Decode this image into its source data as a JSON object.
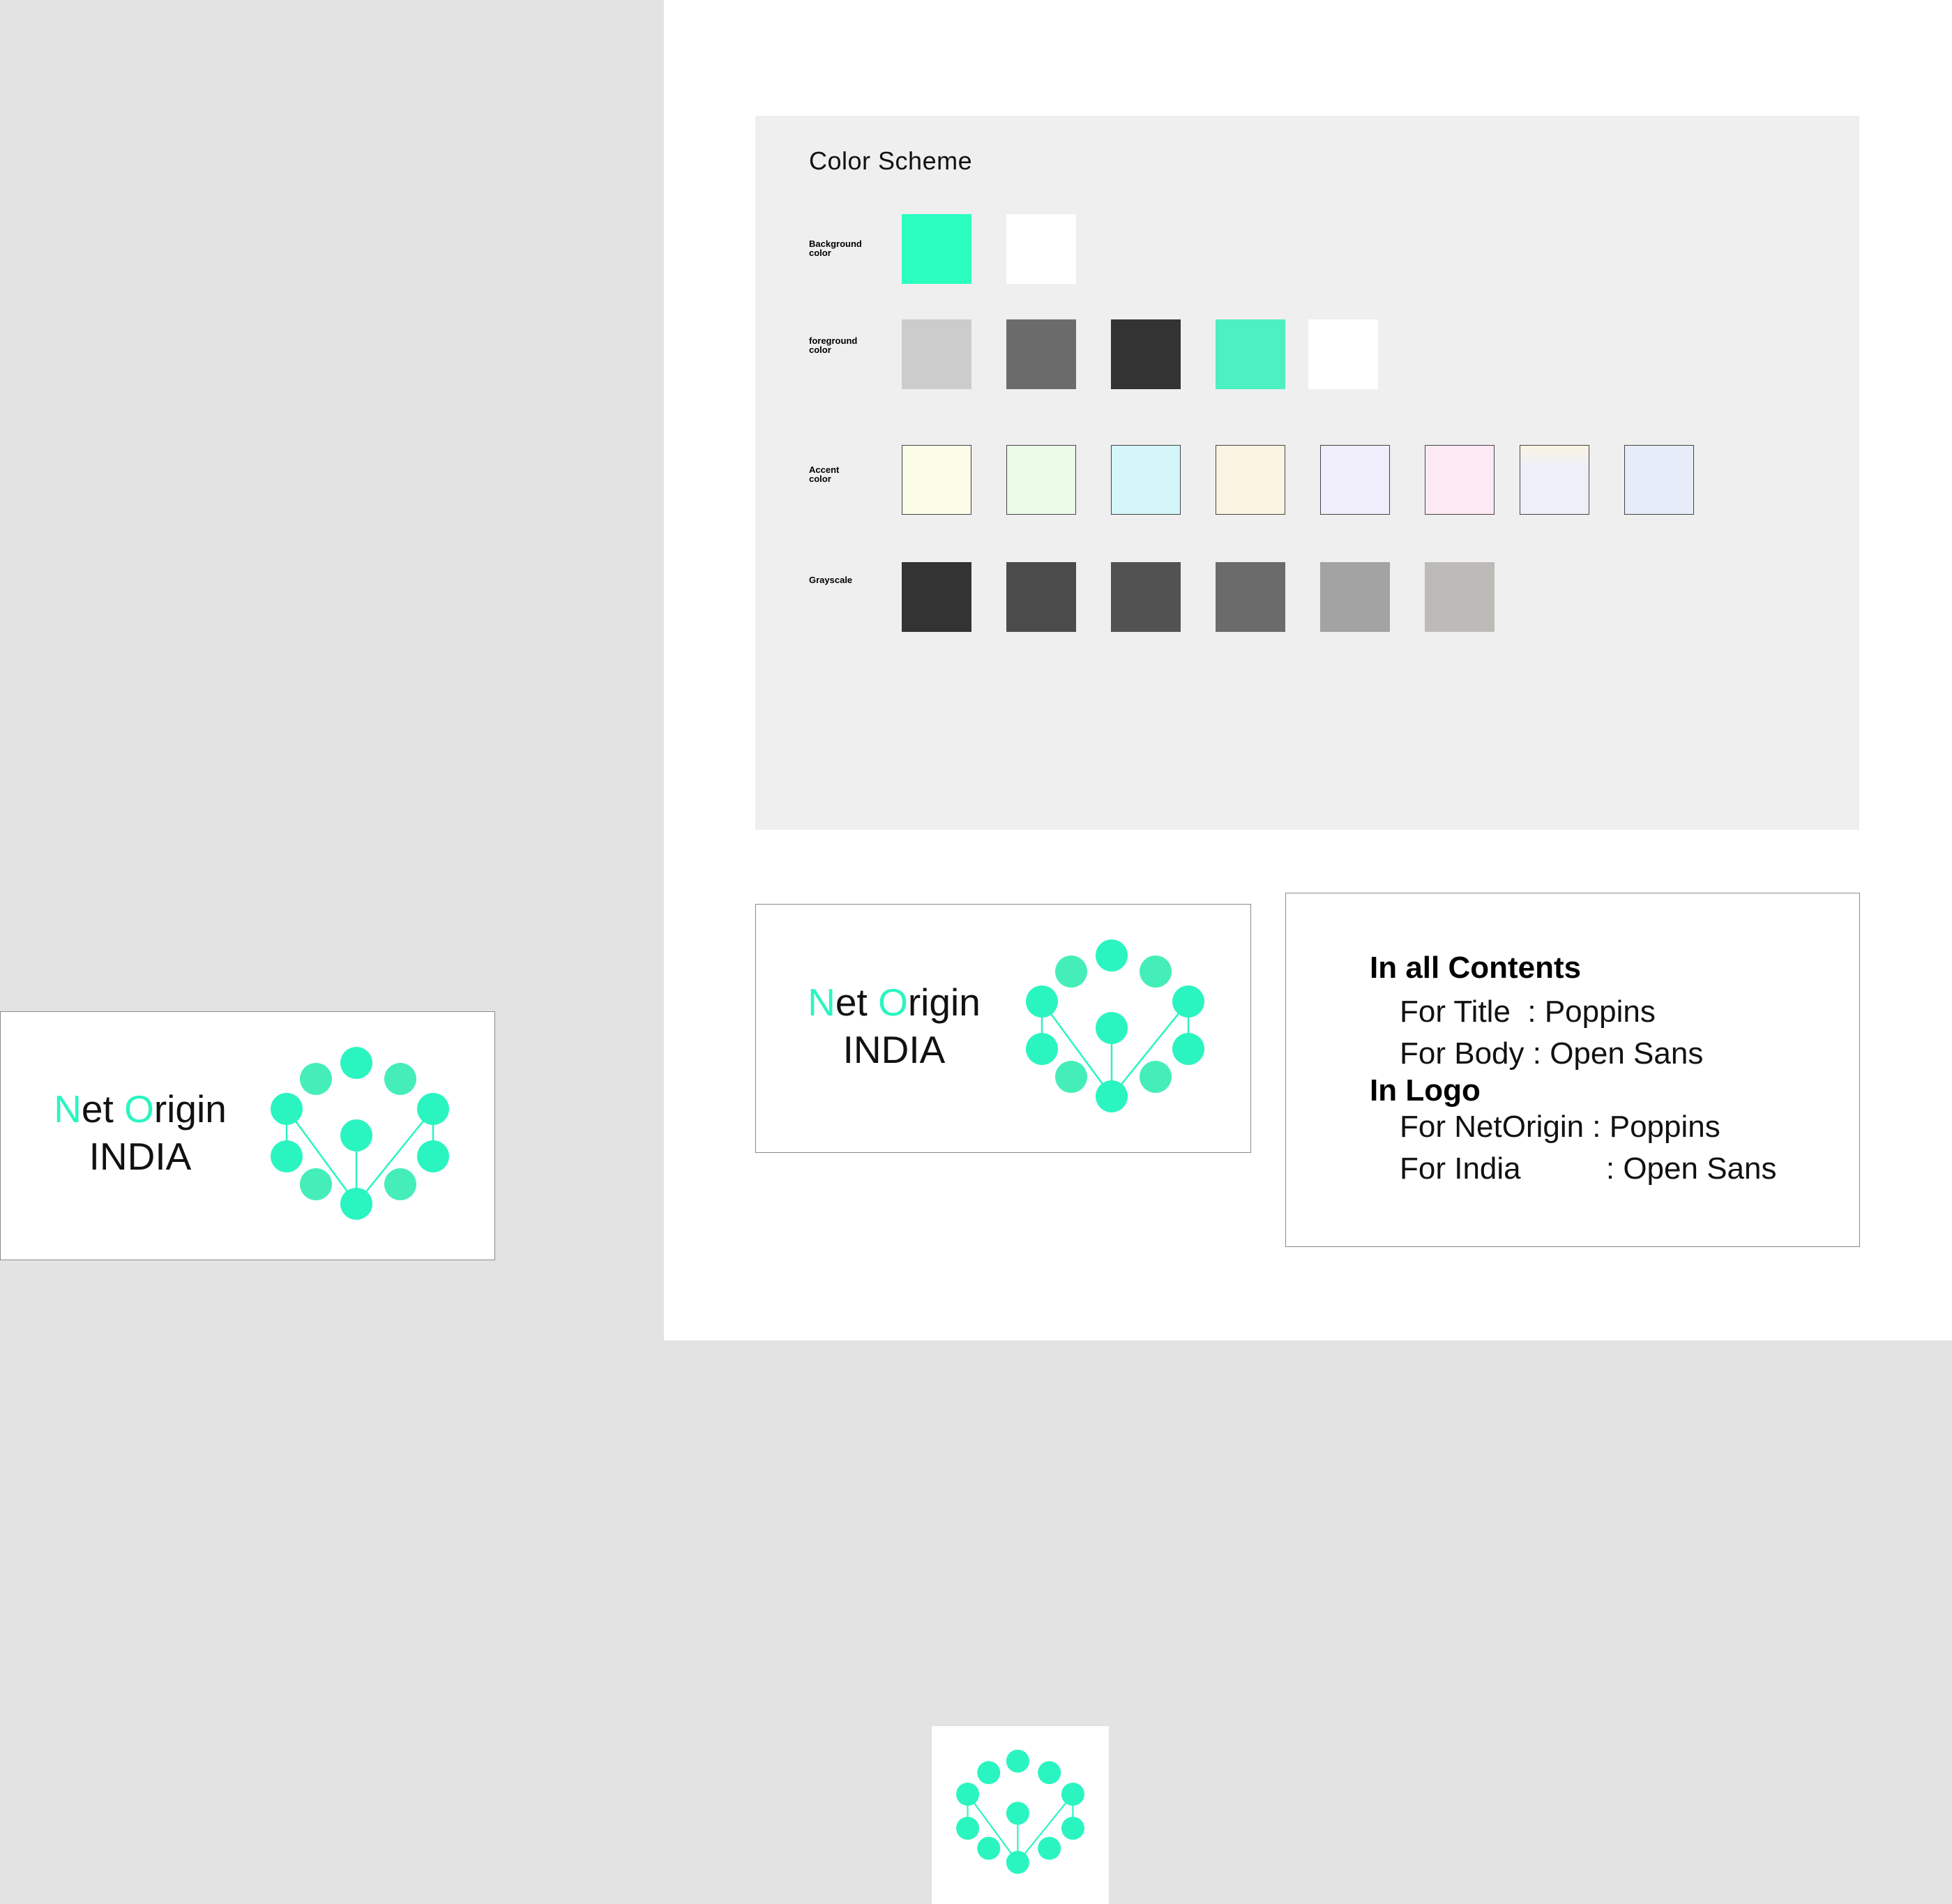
{
  "color_scheme": {
    "title": "Color Scheme",
    "rows": [
      {
        "label_line1": "Background",
        "label_line2": "color",
        "swatches": [
          "#2affc0",
          "#ffffff"
        ]
      },
      {
        "label_line1": "foreground",
        "label_line2": "color",
        "swatches": [
          "#cccccc",
          "#6b6b6b",
          "#333333",
          "#4df0c0",
          "#ffffff"
        ]
      },
      {
        "label_line1": "Accent",
        "label_line2": "color",
        "swatches": [
          "#fbfde9",
          "#ebfbe7",
          "#d4f6f9",
          "#faf4e3",
          "#f0eefb",
          "#fde9f4",
          "#eef0f8",
          "#e6ecf8"
        ]
      },
      {
        "label_line1": "Grayscale",
        "label_line2": "",
        "swatches": [
          "#333333",
          "#4b4b4b",
          "#525252",
          "#6b6b6b",
          "#a3a3a3",
          "#bcbbb8"
        ]
      }
    ]
  },
  "logo": {
    "net": "Net",
    "origin": "Origin",
    "india": "INDIA",
    "accent_color": "#2af5c0",
    "text_color": "#111111"
  },
  "fonts": {
    "heading_contents": "In all Contents",
    "title_label": "For Title  : Poppins",
    "body_label": "For Body : Open Sans",
    "heading_logo": "In Logo",
    "netorigin_label": "For NetOrigin : Poppins",
    "india_label": "For India          : Open Sans"
  }
}
